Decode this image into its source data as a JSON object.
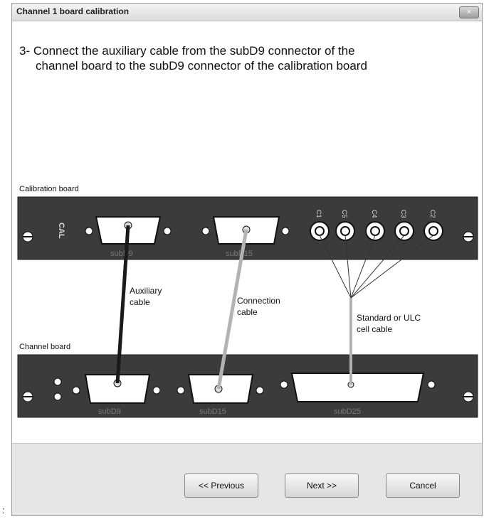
{
  "window": {
    "title": "Channel 1 board calibration",
    "close_glyph": "×"
  },
  "instruction": {
    "line1": "3- Connect the auxiliary cable from the subD9 connector of the",
    "line2": "channel board to the subD9 connector of the calibration board"
  },
  "diagram": {
    "calibration_board_label": "Calibration board",
    "channel_board_label": "Channel board",
    "cal_logo": "CAL",
    "cal_subd9_label": "subD9",
    "cal_subd15_label": "subD15",
    "bnc_labels": [
      "C1",
      "C5",
      "C4",
      "C3",
      "C2"
    ],
    "ch_subd9_label": "subD9",
    "ch_subd15_label": "subD15",
    "ch_subd25_label": "subD25",
    "aux_cable_label": [
      "Auxiliary",
      "cable"
    ],
    "connection_cable_label": [
      "Connection",
      "cable"
    ],
    "cell_cable_label": [
      "Standard or ULC",
      "cell cable"
    ]
  },
  "footer": {
    "previous_label": "<< Previous",
    "next_label": "Next >>",
    "cancel_label": "Cancel"
  },
  "margin_mark": ":"
}
